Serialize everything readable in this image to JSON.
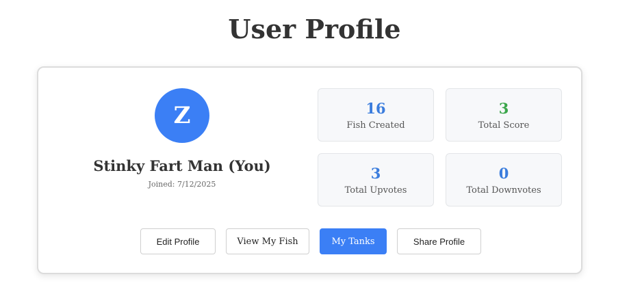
{
  "page": {
    "title": "User Profile"
  },
  "profile": {
    "avatar_letter": "Z",
    "name": "Stinky Fart Man (You)",
    "joined": "Joined: 7/12/2025"
  },
  "stats": [
    {
      "value": "16",
      "label": "Fish Created",
      "color": "#3b7ddd"
    },
    {
      "value": "3",
      "label": "Total Score",
      "color": "#3aa64a"
    },
    {
      "value": "3",
      "label": "Total Upvotes",
      "color": "#3b7ddd"
    },
    {
      "value": "0",
      "label": "Total Downvotes",
      "color": "#3b7ddd"
    }
  ],
  "actions": {
    "edit_profile": "Edit Profile",
    "view_my_fish": "View My Fish",
    "my_tanks": "My Tanks",
    "share_profile": "Share Profile"
  },
  "colors": {
    "accent": "#3b7ff5",
    "score_green": "#3aa64a"
  }
}
